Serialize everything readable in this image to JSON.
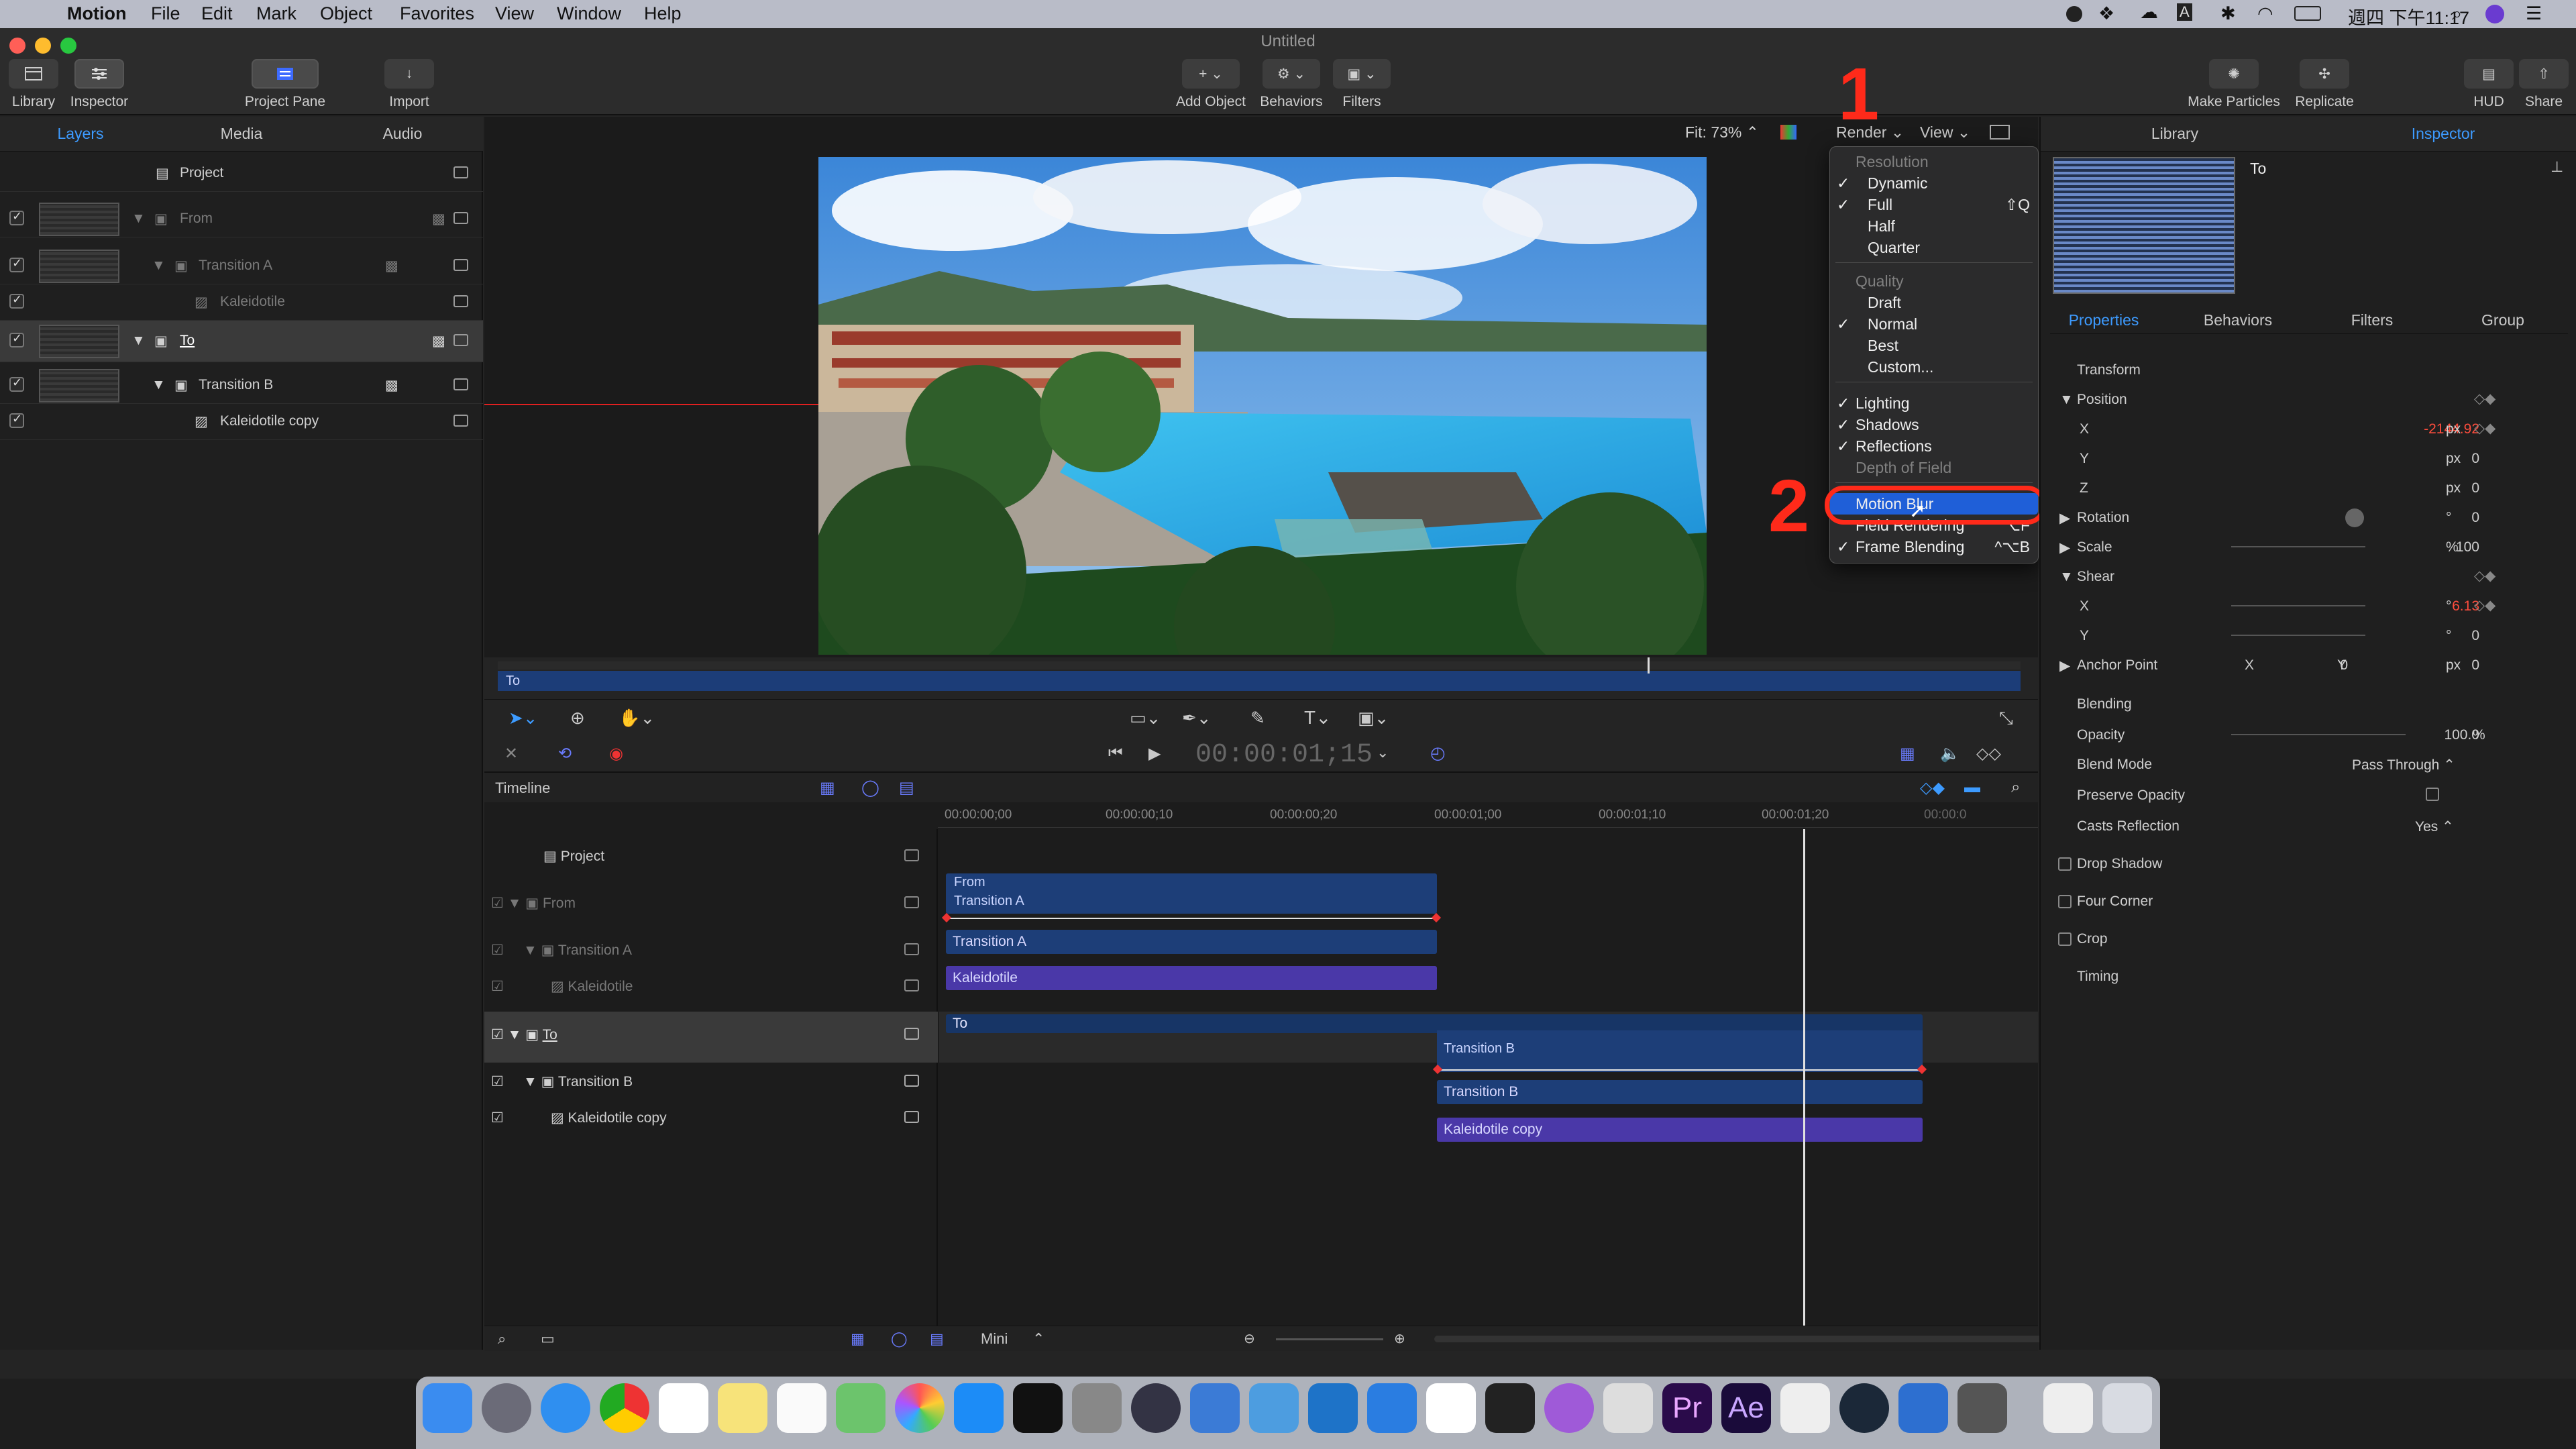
{
  "menubar": {
    "app": "Motion",
    "items": [
      "File",
      "Edit",
      "Mark",
      "Object",
      "Favorites",
      "View",
      "Window",
      "Help"
    ],
    "clock": "週四 下午11:17"
  },
  "window": {
    "title": "Untitled"
  },
  "toolbar": {
    "library": "Library",
    "inspector": "Inspector",
    "project_pane": "Project Pane",
    "import": "Import",
    "add_object": "Add Object",
    "behaviors": "Behaviors",
    "filters": "Filters",
    "make_particles": "Make Particles",
    "replicate": "Replicate",
    "hud": "HUD",
    "share": "Share"
  },
  "left_tabs": [
    "Layers",
    "Media",
    "Audio"
  ],
  "layers": [
    {
      "name": "Project",
      "indent": 0,
      "dim": false
    },
    {
      "name": "From",
      "indent": 1,
      "dim": true
    },
    {
      "name": "Transition A",
      "indent": 2,
      "dim": true
    },
    {
      "name": "Kaleidotile",
      "indent": 3,
      "dim": true
    },
    {
      "name": "To",
      "indent": 1,
      "dim": false
    },
    {
      "name": "Transition B",
      "indent": 2,
      "dim": false
    },
    {
      "name": "Kaleidotile copy",
      "indent": 3,
      "dim": false
    }
  ],
  "canvas_bar": {
    "fit": "Fit: 73%",
    "render": "Render",
    "view": "View"
  },
  "render_menu": {
    "resolution_header": "Resolution",
    "dynamic": "Dynamic",
    "full": "Full",
    "full_shortcut": "⇧Q",
    "half": "Half",
    "quarter": "Quarter",
    "quality_header": "Quality",
    "draft": "Draft",
    "normal": "Normal",
    "best": "Best",
    "custom": "Custom...",
    "lighting": "Lighting",
    "shadows": "Shadows",
    "reflections": "Reflections",
    "depth_of_field": "Depth of Field",
    "motion_blur": "Motion Blur",
    "field_rendering": "Field Rendering",
    "field_rendering_shortcut": "⌥F",
    "frame_blending": "Frame Blending",
    "frame_blending_shortcut": "^⌥B"
  },
  "annotations": {
    "step1": "1",
    "step2": "2",
    "annotation_color": "#ff2a1a"
  },
  "mini_timeline": {
    "label": "To"
  },
  "transport": {
    "timecode": "00:00:01;15"
  },
  "timeline": {
    "title": "Timeline",
    "ruler": [
      "00:00:00;00",
      "00:00:00;10",
      "00:00:00;20",
      "00:00:01;00",
      "00:00:01;10",
      "00:00:01;20",
      "00:00:0"
    ],
    "rows": [
      {
        "name": "Project",
        "dim": false
      },
      {
        "name": "From",
        "dim": true
      },
      {
        "name": "Transition A",
        "dim": true
      },
      {
        "name": "Kaleidotile",
        "dim": true
      },
      {
        "name": "To",
        "dim": false
      },
      {
        "name": "Transition B",
        "dim": false
      },
      {
        "name": "Kaleidotile copy",
        "dim": false
      }
    ],
    "bars": {
      "from": "From",
      "transition_a_top": "Transition A",
      "transition_a": "Transition A",
      "kaleidotile": "Kaleidotile",
      "to": "To",
      "transition_b_top": "Transition B",
      "transition_b": "Transition B",
      "kaleidotile_copy": "Kaleidotile copy"
    },
    "footer": {
      "mini": "Mini"
    }
  },
  "inspector": {
    "tabs_top": [
      "Library",
      "Inspector"
    ],
    "object_name": "To",
    "tabs": [
      "Properties",
      "Behaviors",
      "Filters",
      "Group"
    ],
    "transform": "Transform",
    "position": "Position",
    "x": "X",
    "y": "Y",
    "z": "Z",
    "pos_x": "-2144.92",
    "pos_y": "0",
    "pos_z": "0",
    "px": "px",
    "rotation": "Rotation",
    "rotation_val": "0",
    "deg": "°",
    "scale": "Scale",
    "scale_val": "100",
    "pct": "%",
    "shear": "Shear",
    "shear_x": "6.13",
    "shear_y": "0",
    "anchor_point": "Anchor Point",
    "anchor_x": "0",
    "anchor_y": "0",
    "blending": "Blending",
    "opacity": "Opacity",
    "opacity_val": "100.0",
    "blend_mode": "Blend Mode",
    "blend_mode_val": "Pass Through",
    "preserve_opacity": "Preserve Opacity",
    "casts_reflection": "Casts Reflection",
    "casts_reflection_val": "Yes",
    "drop_shadow": "Drop Shadow",
    "four_corner": "Four Corner",
    "crop": "Crop",
    "timing": "Timing"
  }
}
